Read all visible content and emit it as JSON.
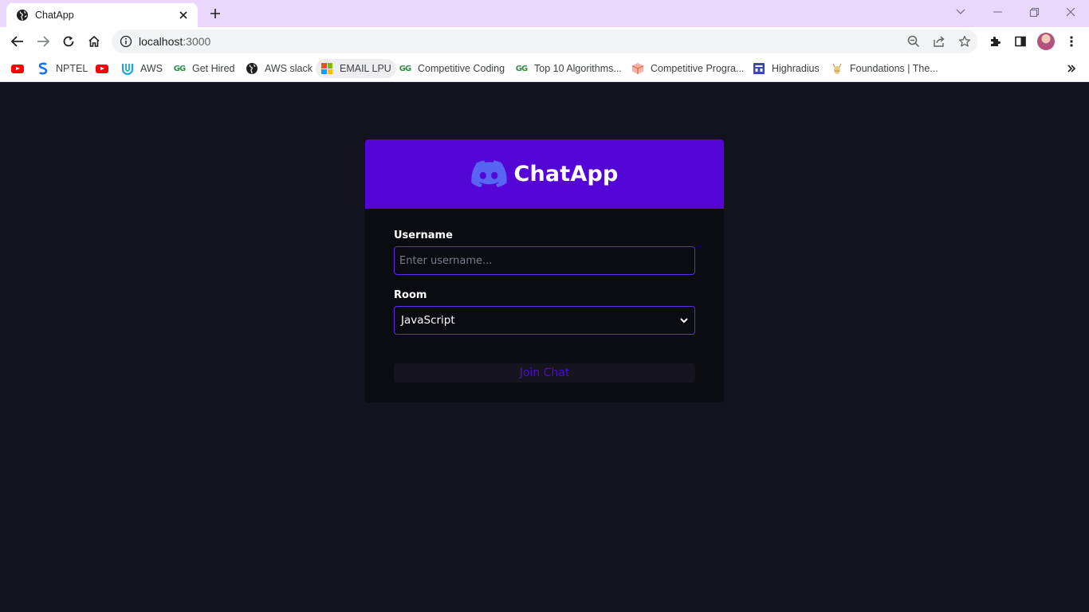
{
  "browser": {
    "tab": {
      "title": "ChatApp"
    },
    "url": {
      "host": "localhost",
      "port": ":3000"
    },
    "bookmarks": [
      {
        "label": "",
        "icon": "youtube-icon"
      },
      {
        "label": "NPTEL",
        "icon": "nptel-icon"
      },
      {
        "label": "",
        "icon": "youtube-icon"
      },
      {
        "label": "AWS",
        "icon": "aws-academy-icon"
      },
      {
        "label": "Get Hired",
        "icon": "gfg-icon"
      },
      {
        "label": "AWS slack",
        "icon": "globe-icon"
      },
      {
        "label": "EMAIL LPU",
        "icon": "microsoft-icon"
      },
      {
        "label": "Competitive Coding",
        "icon": "gfg-icon"
      },
      {
        "label": "Top 10 Algorithms...",
        "icon": "gfg-icon"
      },
      {
        "label": "Competitive Progra...",
        "icon": "cube-icon"
      },
      {
        "label": "Highradius",
        "icon": "highradius-icon"
      },
      {
        "label": "Foundations | The...",
        "icon": "odin-icon"
      }
    ]
  },
  "app": {
    "brand": "ChatApp",
    "username": {
      "label": "Username",
      "placeholder": "Enter username..."
    },
    "room": {
      "label": "Room",
      "selected": "JavaScript"
    },
    "join_label": "Join Chat"
  },
  "colors": {
    "header": "#5406d6",
    "page_bg": "#13131f",
    "card_bg": "#0b0b12",
    "border": "#5a2de0",
    "discord": "#5865f2",
    "tabstrip": "#e9d8fb"
  }
}
